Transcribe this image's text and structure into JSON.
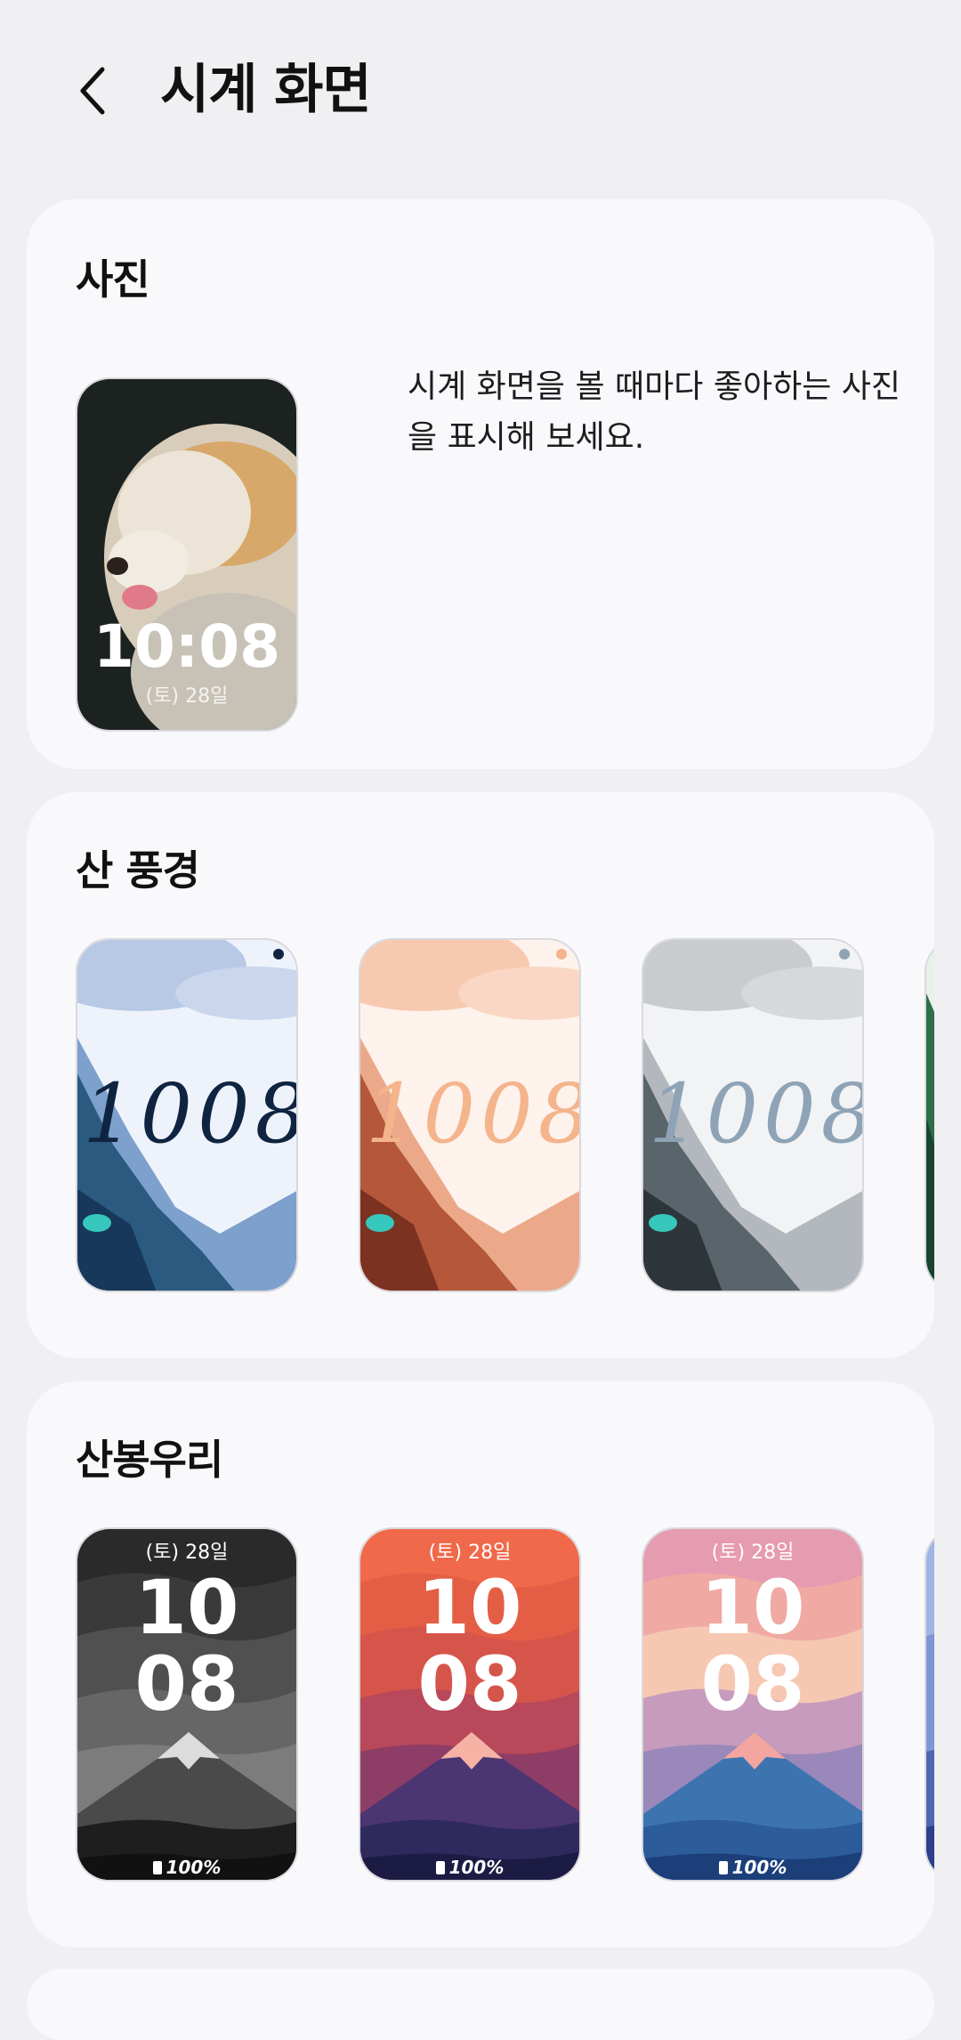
{
  "header": {
    "title": "시계 화면"
  },
  "sections": {
    "photo": {
      "title": "사진",
      "description": "시계 화면을 볼 때마다 좋아하는 사진을 표시해 보세요.",
      "face": {
        "time": "10:08",
        "date": "(토) 28일"
      }
    },
    "mountain_scenery": {
      "title": "산 풍경",
      "digits": "1008",
      "variants": [
        "blue",
        "coral",
        "gray",
        "green"
      ]
    },
    "mountain_peak": {
      "title": "산봉우리",
      "faces": [
        {
          "theme": "monochrome",
          "date": "(토) 28일",
          "hour": "10",
          "minute": "08",
          "battery": "100%"
        },
        {
          "theme": "sunset",
          "date": "(토) 28일",
          "hour": "10",
          "minute": "08",
          "battery": "100%"
        },
        {
          "theme": "pastel",
          "date": "(토) 28일",
          "hour": "10",
          "minute": "08",
          "battery": "100%"
        },
        {
          "theme": "blue"
        }
      ]
    }
  },
  "colors": {
    "background": "#f0f0f3",
    "card": "#f9f9fc",
    "text": "#111111"
  }
}
